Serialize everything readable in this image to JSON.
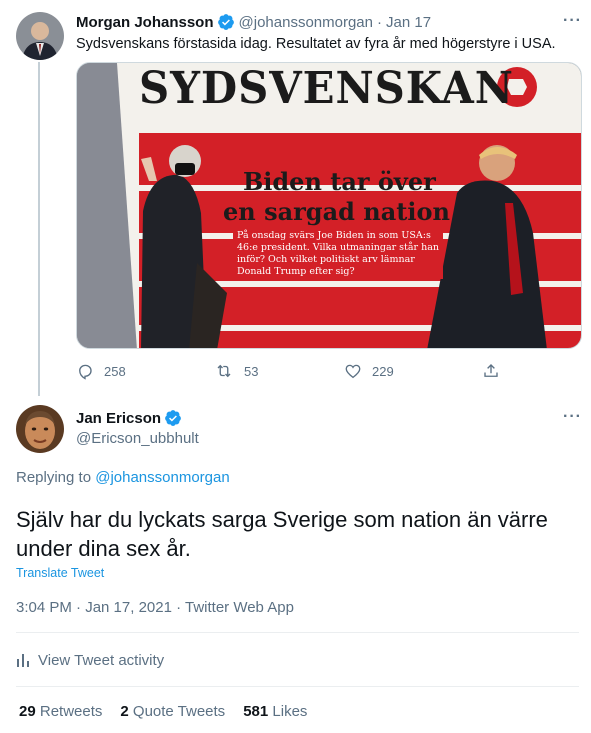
{
  "tweet1": {
    "author_name": "Morgan Johansson",
    "handle": "@johanssonmorgan",
    "separator": "·",
    "date": "Jan 17",
    "text": "Sydsvenskans förstasida idag. Resultatet av fyra år med högerstyre i USA.",
    "newspaper": {
      "masthead": "SYDSVENSKAN",
      "headline_line1": "Biden tar över",
      "headline_line2": "en sargad nation",
      "dek_line1": "På onsdag svärs Joe Biden in som USA:s",
      "dek_line2": "46:e president. Vilka utmaningar står han",
      "dek_line3": "inför? Och vilket politiskt arv lämnar",
      "dek_line4": "Donald Trump efter sig?"
    },
    "stats": {
      "replies": "258",
      "retweets": "53",
      "likes": "229"
    }
  },
  "tweet2": {
    "author_name": "Jan Ericson",
    "handle": "@Ericson_ubbhult",
    "replying_prefix": "Replying to",
    "replying_to": "@johanssonmorgan",
    "text_line1": "Själv har du lyckats sarga Sverige som nation än värre",
    "text_line2": "under dina sex år.",
    "translate": "Translate Tweet",
    "meta": "3:04 PM · Jan 17, 2021 · Twitter Web App",
    "activity": "View Tweet activity",
    "counts": {
      "retweets_num": "29",
      "retweets_label": "Retweets",
      "quotes_num": "2",
      "quotes_label": "Quote Tweets",
      "likes_num": "581",
      "likes_label": "Likes"
    }
  },
  "colors": {
    "accent": "#1b95e0",
    "muted": "#5b7083",
    "text": "#0f1419",
    "news_red": "#d32027"
  },
  "icons": [
    "verified-badge-icon",
    "more-icon",
    "reply-icon",
    "retweet-icon",
    "like-icon",
    "share-icon",
    "activity-icon"
  ]
}
